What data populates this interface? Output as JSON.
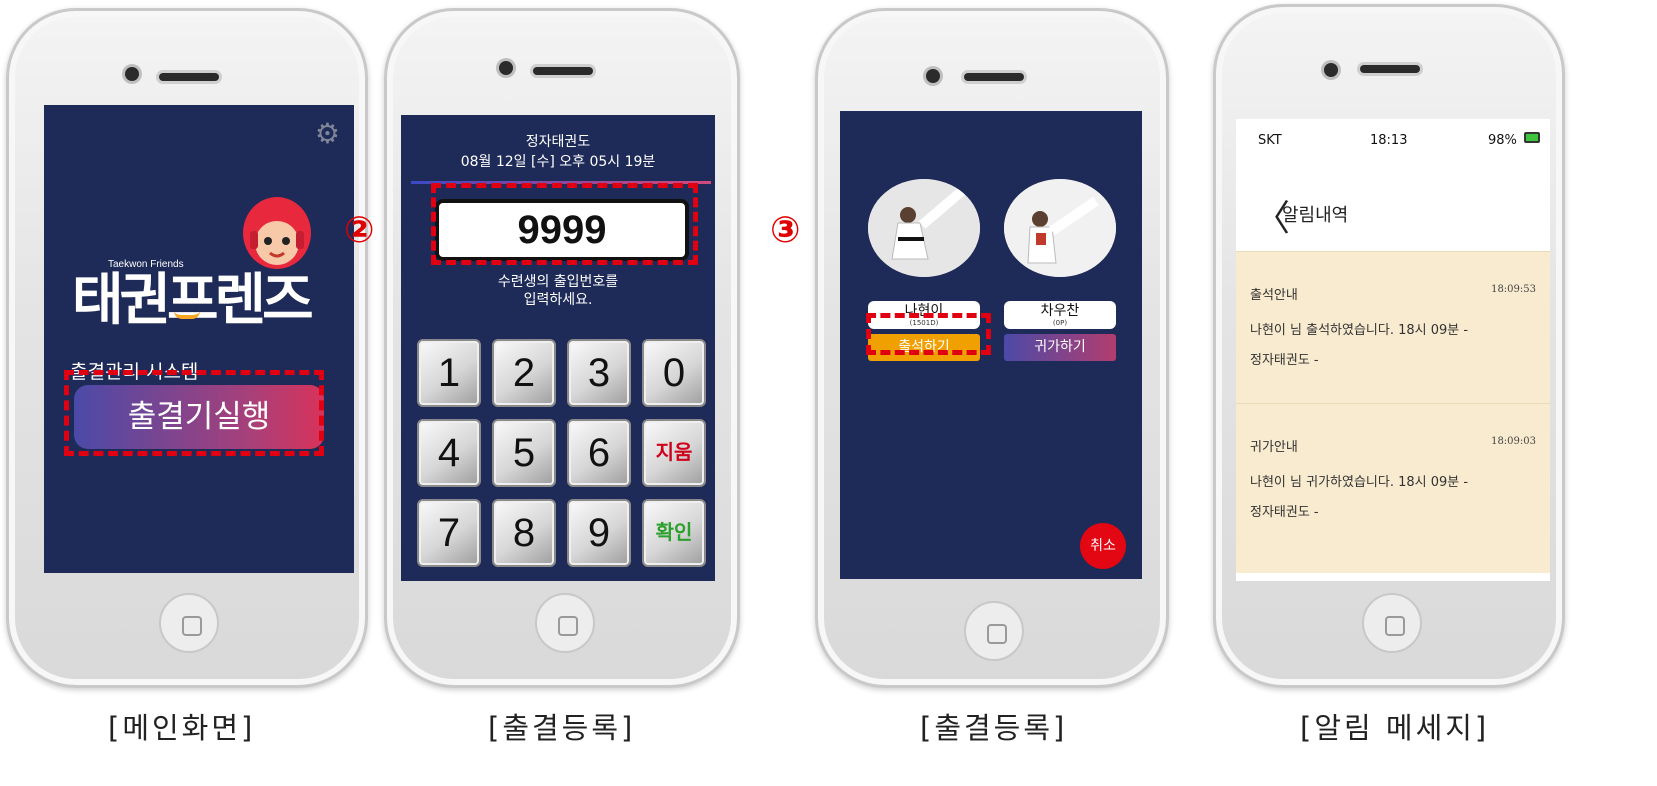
{
  "captions": [
    "[메인화면]",
    "[출결등록]",
    "[출결등록]",
    "[알림 메세지]"
  ],
  "markers": {
    "step2": "②",
    "step3": "③"
  },
  "screen1": {
    "gear_icon": "gear-icon",
    "logo_sub": "Taekwon Friends",
    "logo_main": "태권프렌즈",
    "system_label": "출결관리 시스템",
    "run_button": "출결기실행"
  },
  "screen2": {
    "dojo_name": "정자태권도",
    "datetime": "08월 12일 [수] 오후 05시 19분",
    "code_value": "9999",
    "hint_line1": "수련생의 출입번호를",
    "hint_line2": "입력하세요.",
    "keys": [
      "1",
      "2",
      "3",
      "0",
      "4",
      "5",
      "6",
      "지움",
      "7",
      "8",
      "9",
      "확인"
    ]
  },
  "screen3": {
    "students": [
      {
        "name": "나현이",
        "code": "(1501D)",
        "button": "출석하기"
      },
      {
        "name": "차우찬",
        "code": "(0P)",
        "button": "귀가하기"
      }
    ],
    "cancel_button": "취소",
    "colors": {
      "attend": "#f0a000",
      "home": "#7a3f8f"
    }
  },
  "screen4": {
    "carrier": "SKT",
    "time": "18:13",
    "battery": "98%",
    "title": "알림내역",
    "notifications": [
      {
        "title": "출석안내",
        "time": "18:09:53",
        "body": "나현이 님 출석하였습니다. 18시 09분 - 정자태권도 -"
      },
      {
        "title": "귀가안내",
        "time": "18:09:03",
        "body": "나현이 님 귀가하였습니다. 18시 09분 - 정자태권도 -"
      }
    ]
  }
}
